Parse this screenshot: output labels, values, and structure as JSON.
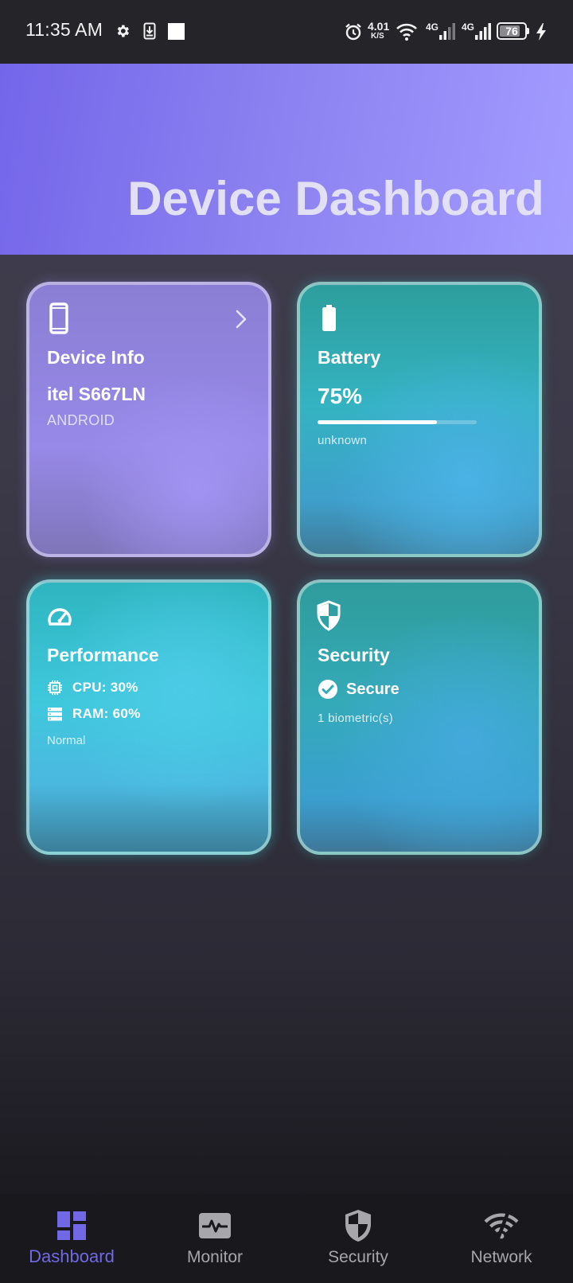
{
  "status_bar": {
    "time": "11:35 AM",
    "net_speed_value": "4.01",
    "net_speed_unit": "K/S",
    "sim1_label": "4G",
    "sim2_label": "4G",
    "battery_level": "76",
    "icons": [
      "settings-gear-icon",
      "download-icon",
      "white-square-icon",
      "alarm-icon",
      "wifi-icon",
      "signal-icon",
      "battery-icon",
      "charging-bolt-icon"
    ]
  },
  "header": {
    "title": "Device Dashboard",
    "colors": {
      "start": "#7466ea",
      "end": "#a39cff"
    }
  },
  "cards": {
    "device_info": {
      "title": "Device Info",
      "model": "itel S667LN",
      "os": "ANDROID",
      "icon": "smartphone-icon",
      "action_icon": "chevron-right-icon"
    },
    "battery": {
      "title": "Battery",
      "level_text": "75%",
      "level_fraction": 0.75,
      "status": "unknown",
      "icon": "battery-icon"
    },
    "performance": {
      "title": "Performance",
      "cpu_text": "CPU: 30%",
      "ram_text": "RAM: 60%",
      "status": "Normal",
      "icon": "speedometer-icon"
    },
    "security": {
      "title": "Security",
      "status": "Secure",
      "biometrics": "1 biometric(s)",
      "icon": "shield-icon"
    }
  },
  "bottom_nav": {
    "active_color": "#7268e6",
    "inactive_color": "#a6a6ab",
    "items": [
      {
        "label": "Dashboard",
        "icon": "dashboard-icon",
        "active": true
      },
      {
        "label": "Monitor",
        "icon": "monitor-icon",
        "active": false
      },
      {
        "label": "Security",
        "icon": "security-shield-icon",
        "active": false
      },
      {
        "label": "Network",
        "icon": "network-icon",
        "active": false
      }
    ]
  }
}
